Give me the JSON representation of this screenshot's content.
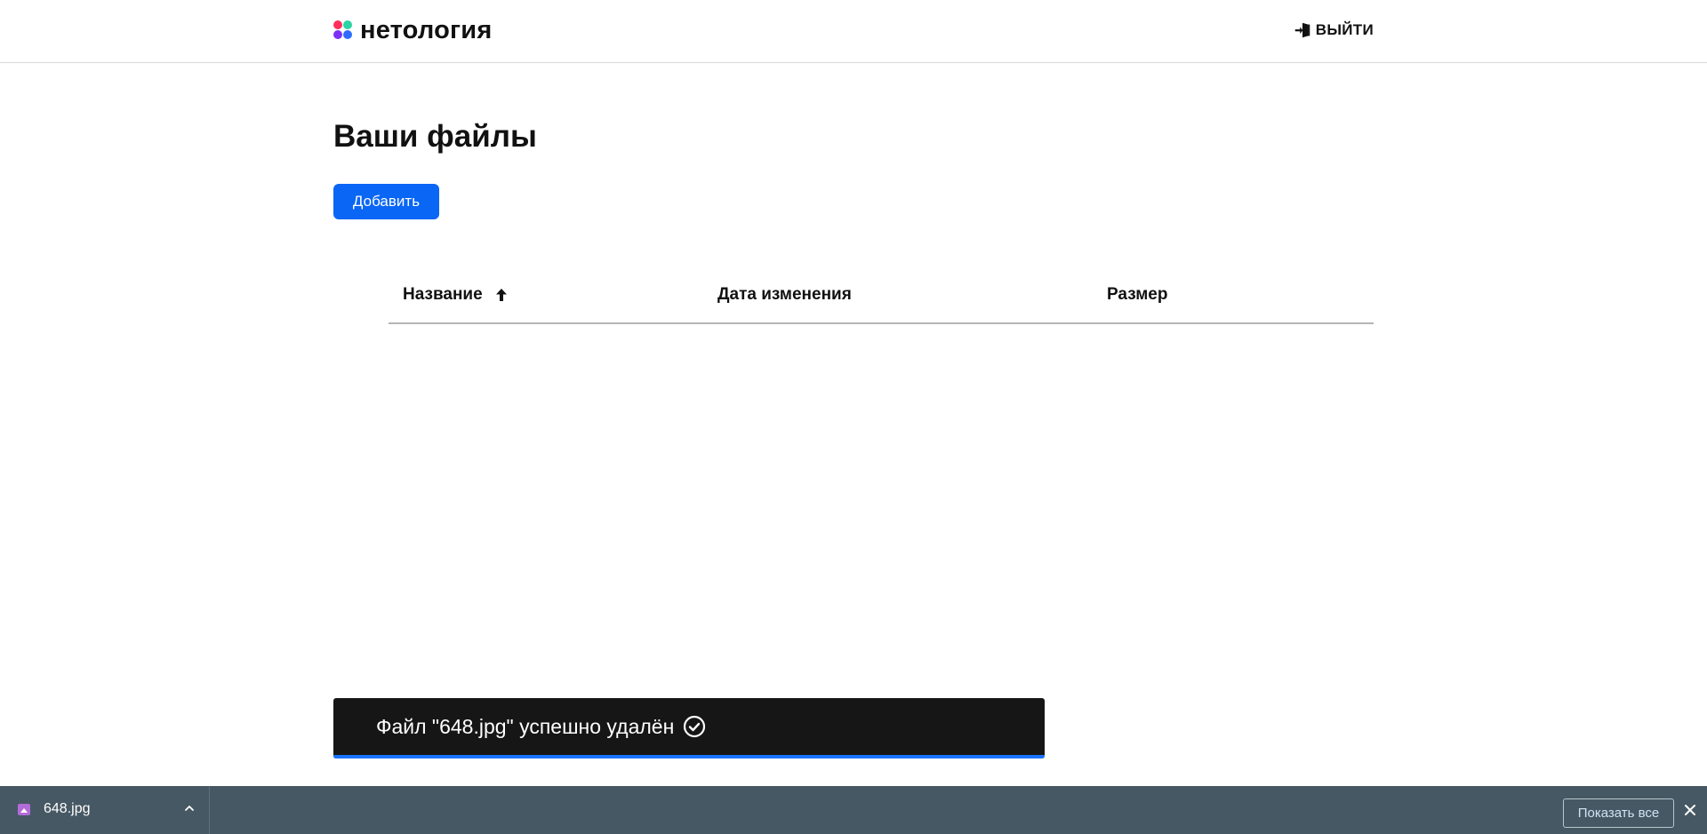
{
  "header": {
    "logo_text": "нетология",
    "logout_label": "ВЫЙТИ"
  },
  "main": {
    "title": "Ваши файлы",
    "add_button_label": "Добавить",
    "table": {
      "columns": [
        {
          "label": "Название",
          "sorted": "ascending",
          "sort_icon": "arrow-up-icon"
        },
        {
          "label": "Дата изменения"
        },
        {
          "label": "Размер"
        }
      ],
      "rows": []
    }
  },
  "toast": {
    "message": "Файл \"648.jpg\" успешно удалён",
    "icon": "check-circle-icon",
    "progress": 1.0,
    "accent_color": "#1a73ff"
  },
  "download_bar": {
    "file_name": "648.jpg",
    "show_all_label": "Показать все"
  },
  "colors": {
    "primary_button": "#0a66f5",
    "toast_background": "#161616",
    "download_bar_background": "#465863"
  }
}
